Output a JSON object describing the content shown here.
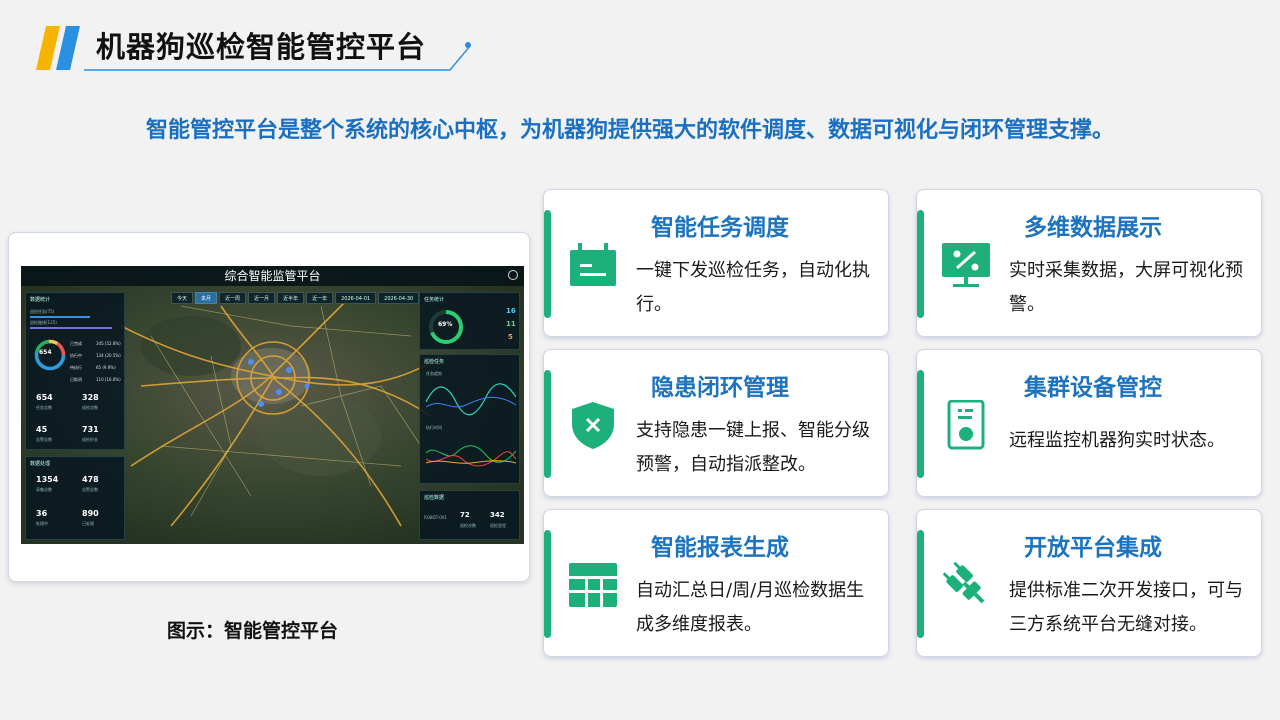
{
  "page": {
    "title": "机器狗巡检智能管控平台",
    "subtitle": "智能管控平台是整个系统的核心中枢，为机器狗提供强大的软件调度、数据可视化与闭环管理支撑。",
    "caption": "图示：智能管控平台"
  },
  "colors": {
    "accent_blue": "#1e73be",
    "accent_green": "#1db07a",
    "deco_yellow": "#f5b400",
    "deco_blue": "#2a8fe0"
  },
  "dashboard": {
    "title": "综合智能监管平台",
    "tabs": [
      "今天",
      "本月",
      "近一周",
      "近一月",
      "近半年",
      "近一年",
      "2026-04-01",
      "2026-04-30"
    ],
    "active_tab": 1,
    "left_panel": {
      "header": "数据统计",
      "bar1": "巡检任务(75)",
      "bar2": "巡检路线(125)",
      "donut_total": "654",
      "donut_sub": "总数",
      "legend": [
        {
          "name": "已完成",
          "value": "345 (52.8%)"
        },
        {
          "name": "执行中",
          "value": "134 (20.5%)"
        },
        {
          "name": "待执行",
          "value": "65 (9.9%)"
        },
        {
          "name": "已取消",
          "value": "110 (16.8%)"
        }
      ],
      "stats": [
        {
          "num": "654",
          "label": "任务总数"
        },
        {
          "num": "328",
          "label": "巡检次数"
        },
        {
          "num": "45",
          "label": "告警总数"
        },
        {
          "num": "731",
          "label": "巡检时长"
        }
      ],
      "header2": "数据处理",
      "stats2": [
        {
          "num": "1354",
          "label": "采集总数"
        },
        {
          "num": "478",
          "label": "告警总数"
        },
        {
          "num": "36",
          "label": "处理中"
        },
        {
          "num": "890",
          "label": "已处理"
        }
      ]
    },
    "right_panel": {
      "header": "任务统计",
      "gauge": "69%",
      "gauge_sub": "任务完成率",
      "counts": [
        "16",
        "11",
        "5"
      ],
      "header2": "巡检任务",
      "chart1_label": "任务趋势",
      "chart2_label": "执行时间",
      "header3": "巡检数据",
      "robot": "ROBOT-001",
      "stats": [
        {
          "num": "72",
          "label": "巡检次数"
        },
        {
          "num": "342",
          "label": "巡检里程"
        }
      ]
    }
  },
  "cards": [
    {
      "title": "智能任务调度",
      "text": "一键下发巡检任务，自动化执行。",
      "icon": "calendar-icon"
    },
    {
      "title": "多维数据展示",
      "text": "实时采集数据，大屏可视化预警。",
      "icon": "monitor-chart-icon"
    },
    {
      "title": "隐患闭环管理",
      "text": "支持隐患一键上报、智能分级预警，自动指派整改。",
      "icon": "shield-x-icon"
    },
    {
      "title": "集群设备管控",
      "text": "远程监控机器狗实时状态。",
      "icon": "device-icon"
    },
    {
      "title": "智能报表生成",
      "text": "自动汇总日/周/月巡检数据生成多维度报表。",
      "icon": "table-icon"
    },
    {
      "title": "开放平台集成",
      "text": "提供标准二次开发接口，可与三方系统平台无缝对接。",
      "icon": "plug-icon"
    }
  ]
}
